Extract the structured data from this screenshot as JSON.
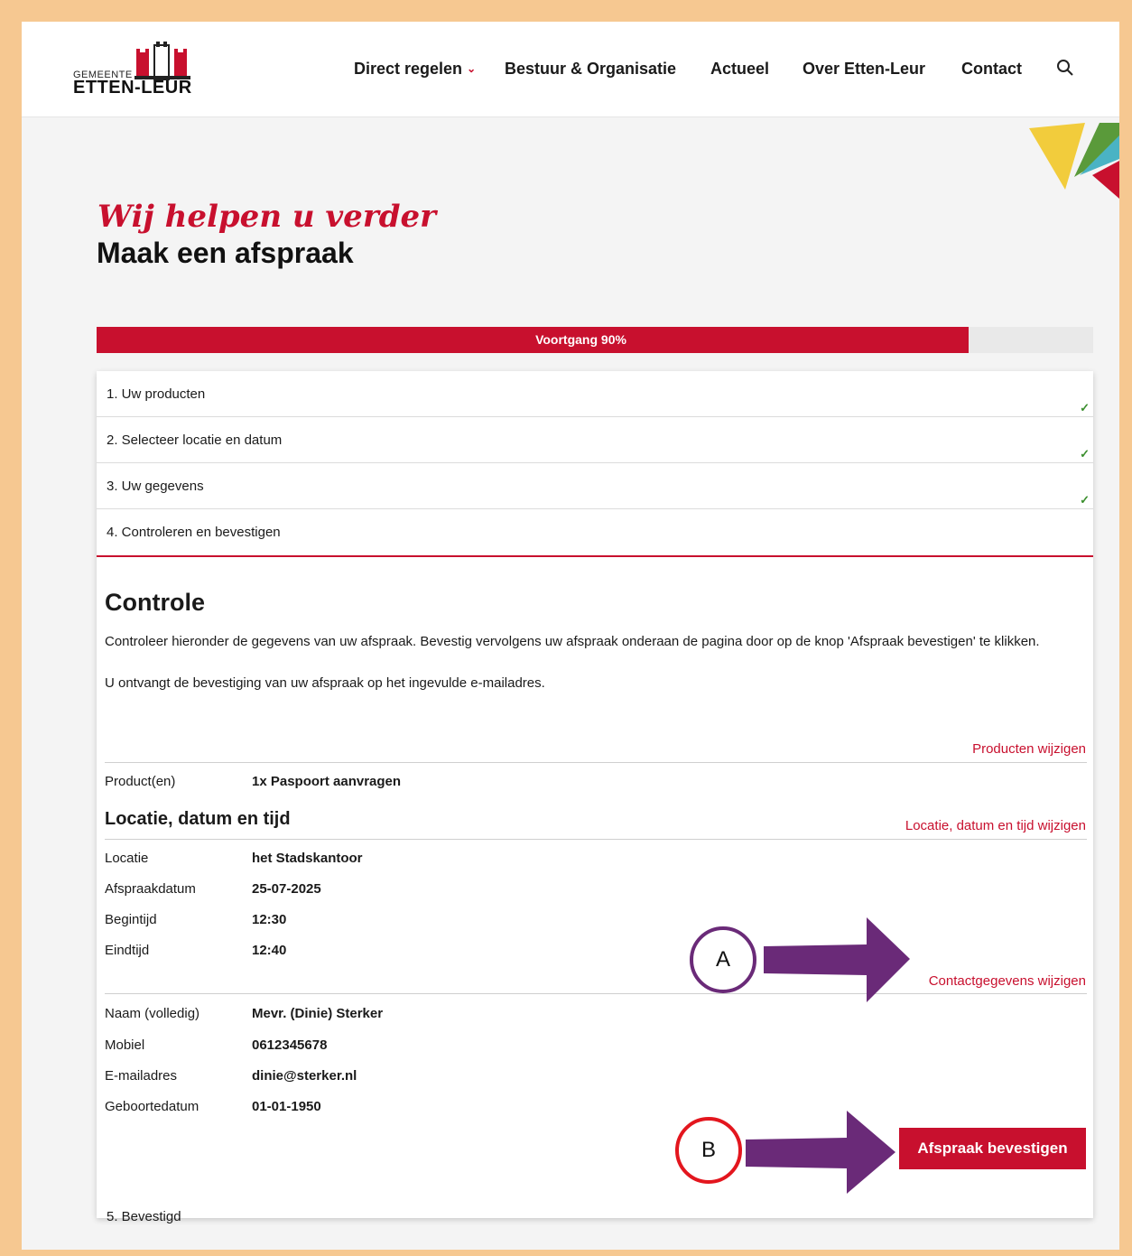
{
  "header": {
    "logo_small": "GEMEENTE",
    "logo_big": "ETTEN-LEUR",
    "nav": [
      {
        "label": "Direct regelen"
      },
      {
        "label": "Bestuur & Organisatie"
      },
      {
        "label": "Actueel"
      },
      {
        "label": "Over Etten-Leur"
      },
      {
        "label": "Contact"
      }
    ],
    "search_icon": "search-icon"
  },
  "hero": {
    "tagline": "Wij helpen u verder",
    "title": "Maak een afspraak"
  },
  "progress": {
    "label": "Voortgang 90%",
    "value": 0.9,
    "color": "#c8102e"
  },
  "steps": [
    {
      "label": "1. Uw producten",
      "done": true
    },
    {
      "label": "2. Selecteer locatie en datum",
      "done": true
    },
    {
      "label": "3. Uw gegevens",
      "done": true
    },
    {
      "label": "4. Controleren en bevestigen",
      "done": false
    }
  ],
  "check_glyph": "✓",
  "controle": {
    "heading": "Controle",
    "intro": "Controleer hieronder de gegevens van uw afspraak. Bevestig vervolgens uw afspraak onderaan de pagina door op de knop 'Afspraak bevestigen' te klikken.",
    "note": "U ontvangt de bevestiging van uw afspraak op het ingevulde e-mailadres.",
    "products_link": "Producten wijzigen",
    "products_label": "Product(en)",
    "products_value": "1x Paspoort aanvragen",
    "location_heading": "Locatie, datum en tijd",
    "location_link": "Locatie, datum en tijd wijzigen",
    "location_rows": [
      {
        "label": "Locatie",
        "value": "het Stadskantoor"
      },
      {
        "label": "Afspraakdatum",
        "value": "25-07-2025"
      },
      {
        "label": "Begintijd",
        "value": "12:30"
      },
      {
        "label": "Eindtijd",
        "value": "12:40"
      }
    ],
    "contact_link": "Contactgegevens wijzigen",
    "contact_rows": [
      {
        "label": "Naam (volledig)",
        "value": "Mevr. (Dinie) Sterker"
      },
      {
        "label": "Mobiel",
        "value": "0612345678"
      },
      {
        "label": "E-mailadres",
        "value": "dinie@sterker.nl"
      },
      {
        "label": "Geboortedatum",
        "value": "01-01-1950"
      }
    ],
    "confirm_button": "Afspraak bevestigen",
    "step5": "5. Bevestigd"
  },
  "annotations": {
    "a": "A",
    "b": "B",
    "a_color": "#6a2a78",
    "b_color": "#e3161e",
    "arrow_color": "#6a2a78"
  }
}
